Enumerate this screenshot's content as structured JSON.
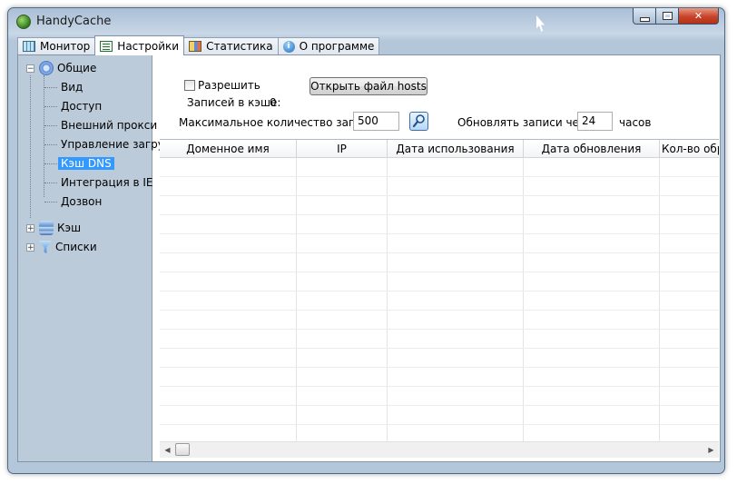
{
  "window": {
    "title": "HandyCache",
    "close_label": "✕"
  },
  "tabs": [
    {
      "label": "Монитор",
      "icon": "monitor-icon"
    },
    {
      "label": "Настройки",
      "icon": "settings-icon",
      "active": true
    },
    {
      "label": "Статистика",
      "icon": "statistics-icon"
    },
    {
      "label": "О программе",
      "icon": "about-icon"
    }
  ],
  "tree": {
    "general": {
      "label": "Общие",
      "expander": "−"
    },
    "children": [
      "Вид",
      "Доступ",
      "Внешний прокси",
      "Управление загру",
      "Кэш DNS",
      "Интеграция в IE",
      "Дозвон"
    ],
    "selected": "Кэш DNS",
    "cache": {
      "label": "Кэш",
      "expander": "+"
    },
    "lists": {
      "label": "Списки",
      "expander": "+"
    }
  },
  "dns": {
    "enable_label": "Разрешить",
    "enable_checked": false,
    "open_hosts_label": "Открыть файл hosts",
    "records_label": "Записей в кэше:",
    "records_value": "0",
    "max_records_label": "Максимальное количество записей:",
    "max_records_value": "500",
    "refresh_label": "Обновлять записи через",
    "refresh_value": "24",
    "hours_label": "часов"
  },
  "table": {
    "columns": [
      "Доменное имя",
      "IP",
      "Дата использования",
      "Дата обновления",
      "Кол-во обра"
    ],
    "rows": []
  },
  "scrollbar": {
    "left": "◀",
    "right": "▶"
  },
  "colors": {
    "selection": "#3399ff",
    "tree_bg": "#bccbda",
    "frame": "#b4c6d9"
  }
}
